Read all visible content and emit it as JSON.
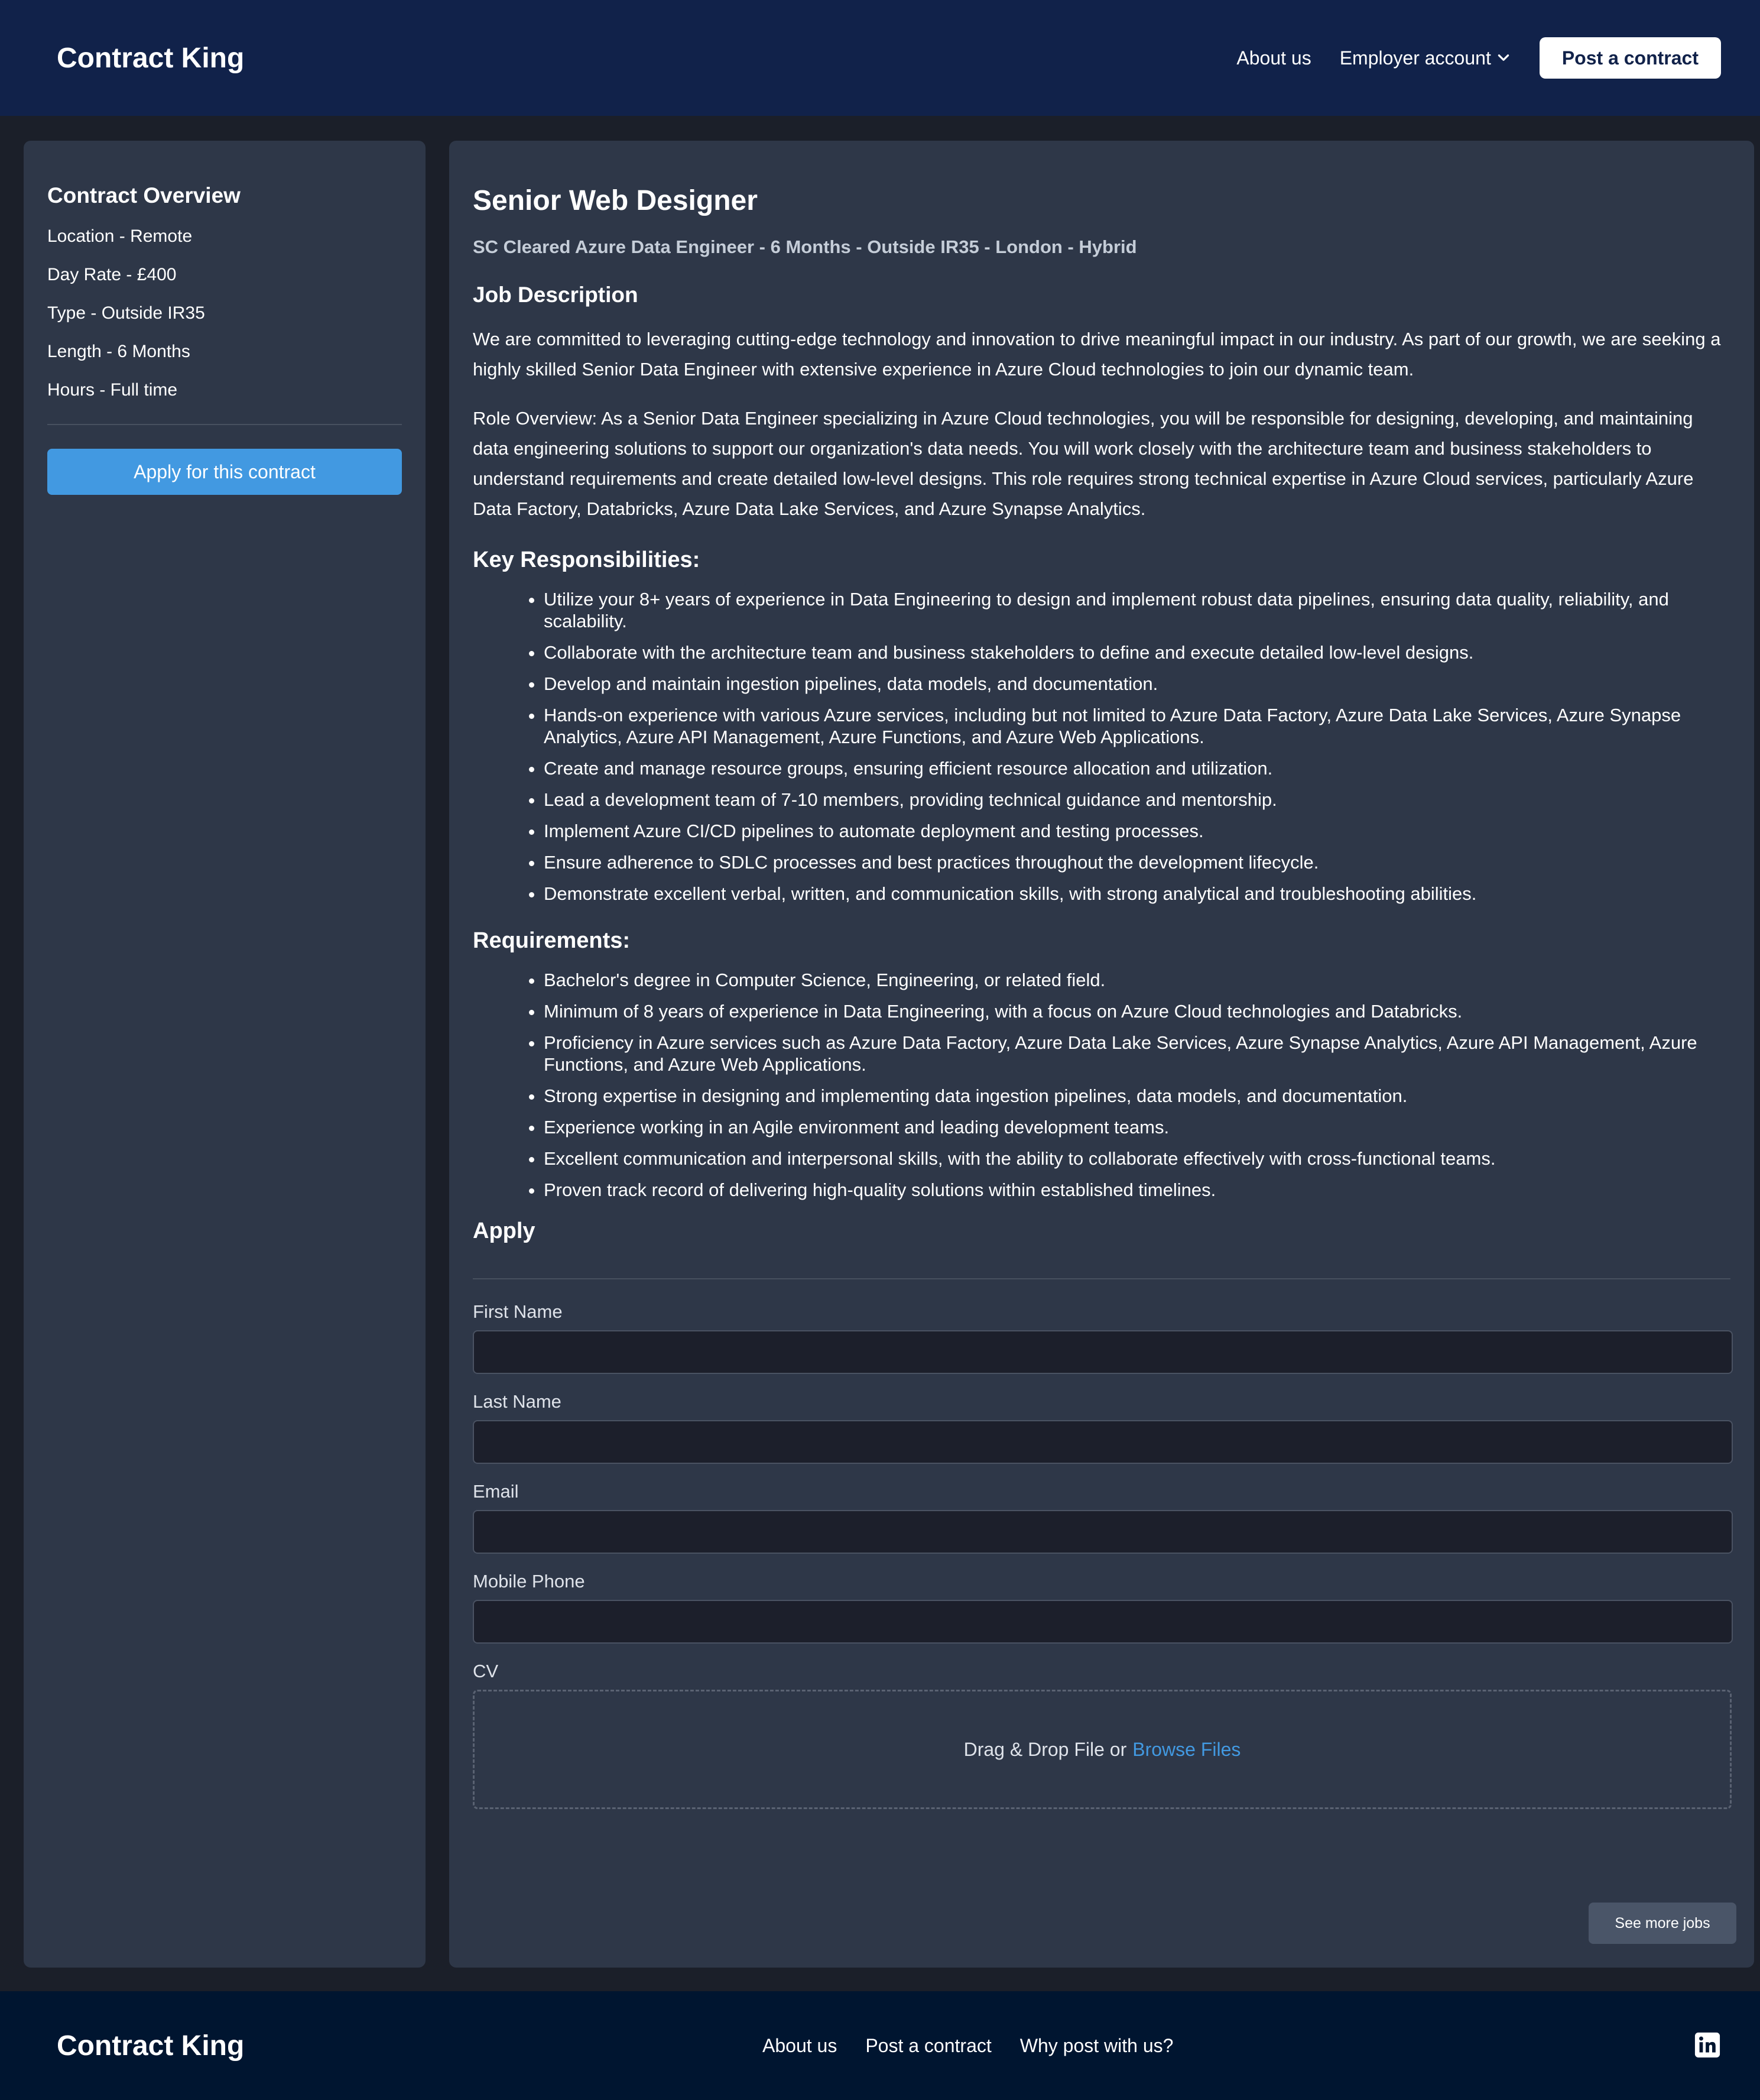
{
  "header": {
    "brand": "Contract King",
    "nav": {
      "about": "About us",
      "employer": "Employer account",
      "post": "Post a contract"
    }
  },
  "sidebar": {
    "title": "Contract Overview",
    "items": [
      "Location - Remote",
      "Day Rate - £400",
      "Type - Outside IR35",
      "Length - 6 Months",
      "Hours - Full time"
    ],
    "apply_button": "Apply for this contract"
  },
  "job": {
    "title": "Senior Web Designer",
    "subtitle": "SC Cleared Azure Data Engineer - 6 Months - Outside IR35 - London - Hybrid",
    "description_heading": "Job Description",
    "paragraphs": [
      "We are committed to leveraging cutting-edge technology and innovation to drive meaningful impact in our industry. As part of our growth, we are seeking a highly skilled Senior Data Engineer with extensive experience in Azure Cloud technologies to join our dynamic team.",
      "Role Overview: As a Senior Data Engineer specializing in Azure Cloud technologies, you will be responsible for designing, developing, and maintaining data engineering solutions to support our organization's data needs. You will work closely with the architecture team and business stakeholders to understand requirements and create detailed low-level designs. This role requires strong technical expertise in Azure Cloud services, particularly Azure Data Factory, Databricks, Azure Data Lake Services, and Azure Synapse Analytics."
    ],
    "responsibilities_heading": "Key Responsibilities:",
    "responsibilities": [
      "Utilize your 8+ years of experience in Data Engineering to design and implement robust data pipelines, ensuring data quality, reliability, and scalability.",
      "Collaborate with the architecture team and business stakeholders to define and execute detailed low-level designs.",
      "Develop and maintain ingestion pipelines, data models, and documentation.",
      "Hands-on experience with various Azure services, including but not limited to Azure Data Factory, Azure Data Lake Services, Azure Synapse Analytics, Azure API Management, Azure Functions, and Azure Web Applications.",
      "Create and manage resource groups, ensuring efficient resource allocation and utilization.",
      "Lead a development team of 7-10 members, providing technical guidance and mentorship.",
      "Implement Azure CI/CD pipelines to automate deployment and testing processes.",
      "Ensure adherence to SDLC processes and best practices throughout the development lifecycle.",
      "Demonstrate excellent verbal, written, and communication skills, with strong analytical and troubleshooting abilities."
    ],
    "requirements_heading": "Requirements:",
    "requirements": [
      "Bachelor's degree in Computer Science, Engineering, or related field.",
      "Minimum of 8 years of experience in Data Engineering, with a focus on Azure Cloud technologies and Databricks.",
      "Proficiency in Azure services such as Azure Data Factory, Azure Data Lake Services, Azure Synapse Analytics, Azure API Management, Azure Functions, and Azure Web Applications.",
      "Strong expertise in designing and implementing data ingestion pipelines, data models, and documentation.",
      "Experience working in an Agile environment and leading development teams.",
      "Excellent communication and interpersonal skills, with the ability to collaborate effectively with cross-functional teams.",
      "Proven track record of delivering high-quality solutions within established timelines."
    ]
  },
  "form": {
    "heading": "Apply",
    "first_name_label": "First Name",
    "first_name_value": "",
    "last_name_label": "Last Name",
    "last_name_value": "",
    "email_label": "Email",
    "email_value": "",
    "phone_label": "Mobile Phone",
    "phone_value": "",
    "cv_label": "CV",
    "dropzone_text": "Drag & Drop File or",
    "browse_text": "Browse Files",
    "see_more": "See more jobs"
  },
  "footer": {
    "brand": "Contract King",
    "links": {
      "about": "About us",
      "post": "Post a contract",
      "why": "Why post with us?"
    },
    "social_icon": "linkedin-icon"
  },
  "colors": {
    "header_bg": "#11224a",
    "page_bg": "#1b1f29",
    "card_bg": "#2e3748",
    "accent": "#4299e1",
    "footer_bg": "#001530"
  }
}
